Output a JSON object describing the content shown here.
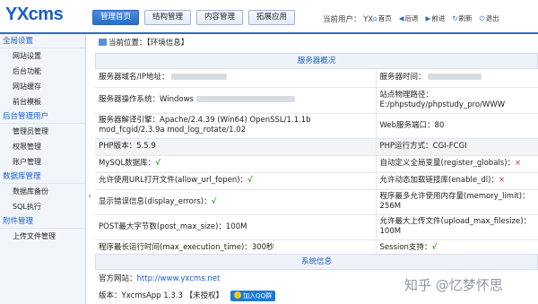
{
  "app": {
    "logo": "YXcms"
  },
  "topnav": [
    "管理首页",
    "结构管理",
    "内容管理",
    "拓展应用"
  ],
  "user": {
    "label": "当前用户：",
    "name": "YX"
  },
  "quick_links": [
    "首页",
    "后退",
    "前进",
    "刷新",
    "退出"
  ],
  "sidebar": [
    {
      "group": "全局设置",
      "items": [
        "网站设置",
        "后台功能",
        "网站缓存",
        "前台模板"
      ]
    },
    {
      "group": "后台管理用户",
      "items": [
        "管理员管理",
        "权限管理",
        "账户管理"
      ]
    },
    {
      "group": "数据库管理",
      "items": [
        "数据库备份",
        "SQL执行"
      ]
    },
    {
      "group": "附件管理",
      "items": [
        "上传文件管理"
      ]
    }
  ],
  "breadcrumb": "当前位置：【环境信息】",
  "server_section": "服务器概况",
  "rows": [
    {
      "l": "服务器域名/IP地址：",
      "r": "服务器时间："
    },
    {
      "l": "服务器操作系统：Windows",
      "r": "站点物理路径：E:/phpstudy/phpstudy_pro/WWW"
    },
    {
      "l": "服务器解译引擎：Apache/2.4.39 (Win64) OpenSSL/1.1.1b mod_fcgid/2.3.9a mod_log_rotate/1.02",
      "r": "Web服务端口：80"
    },
    {
      "l": "PHP版本：5.5.9",
      "r": "PHP运行方式：CGI-FCGI"
    },
    {
      "l": "MySQL数据库：",
      "l_mark": "√",
      "r": "自动定义全局变量(register_globals)：",
      "r_mark": "×"
    },
    {
      "l": "允许使用URL打开文件(allow_url_fopen)：",
      "l_mark": "√",
      "r": "允许动态加载链接库(enable_dl)：",
      "r_mark": "×"
    },
    {
      "l": "显示错误信息(display_errors)：",
      "l_mark": "√",
      "r": "程序最多允许使用内存量(memory_limit)：256M"
    },
    {
      "l": "POST最大字节数(post_max_size)：100M",
      "r": "允许最大上传文件(upload_max_filesize)：100M"
    },
    {
      "l": "程序最长运行时间(max_execution_time)：300秒",
      "r": "Session支持：",
      "r_mark": "√"
    }
  ],
  "system_section": "系统信息",
  "system": {
    "site_label": "官方网站：",
    "site_url": "http://www.yxcms.net",
    "version": "版本：YxcmsApp 1.3.3 【未授权】",
    "qq_button": "加入QQ群"
  },
  "watermark": "知乎 @忆梦怀思"
}
